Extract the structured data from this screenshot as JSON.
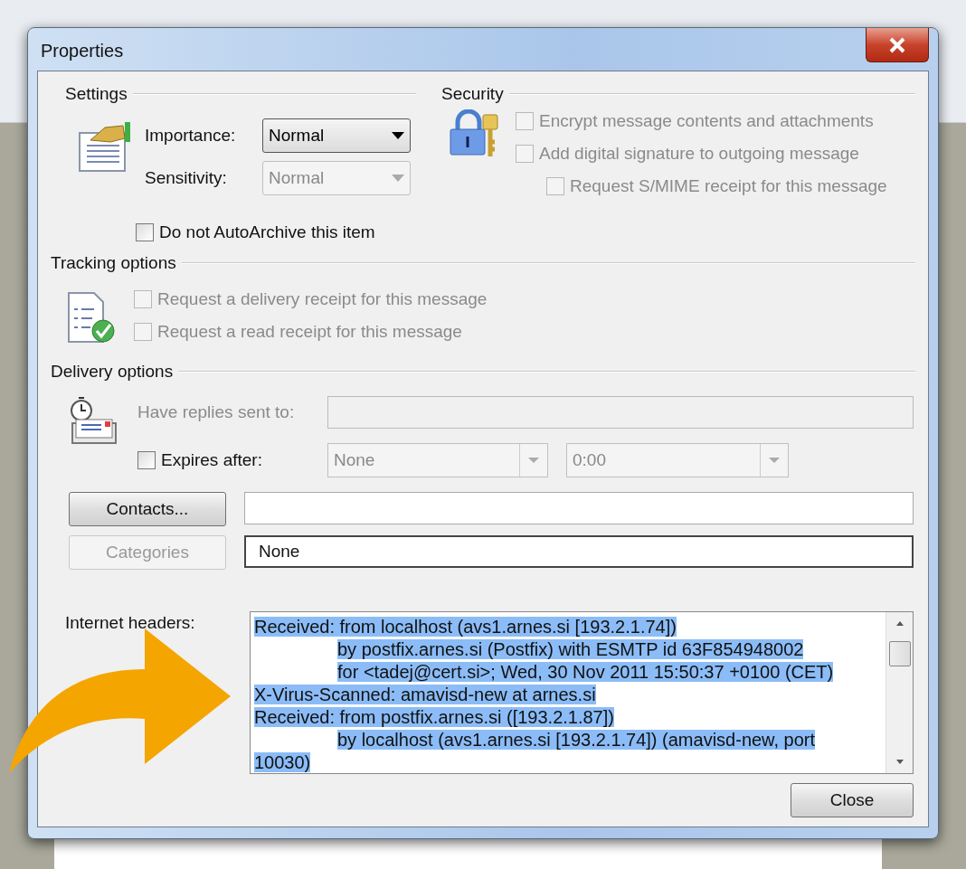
{
  "window": {
    "title": "Properties"
  },
  "settings": {
    "title": "Settings",
    "importance": {
      "label": "Importance:",
      "value": "Normal",
      "disabled": false
    },
    "sensitivity": {
      "label": "Sensitivity:",
      "value": "Normal",
      "disabled": true
    },
    "autoarchive": {
      "label": "Do not AutoArchive this item",
      "checked": false,
      "disabled": false
    }
  },
  "security": {
    "title": "Security",
    "options": [
      {
        "label": "Encrypt message contents and attachments",
        "checked": false,
        "disabled": true,
        "kind": "main"
      },
      {
        "label": "Add digital signature to outgoing message",
        "checked": false,
        "disabled": true,
        "kind": "main"
      },
      {
        "label": "Request S/MIME receipt for this message",
        "checked": false,
        "disabled": true,
        "kind": "sub"
      }
    ]
  },
  "tracking": {
    "title": "Tracking options",
    "options": [
      {
        "label": "Request a delivery receipt for this message",
        "checked": false,
        "disabled": true
      },
      {
        "label": "Request a read receipt for this message",
        "checked": false,
        "disabled": true
      }
    ]
  },
  "delivery": {
    "title": "Delivery options",
    "replies": {
      "label": "Have replies sent to:",
      "disabled": true
    },
    "expires": {
      "label": "Expires after:",
      "checked": false,
      "date": "None",
      "time": "0:00",
      "disabled": true
    },
    "contacts": {
      "label": "Contacts...",
      "disabled": false
    },
    "categories": {
      "label": "Categories",
      "disabled": true,
      "value": "None"
    }
  },
  "headers": {
    "label": "Internet headers:",
    "selected": true,
    "lines": [
      {
        "text": "Received: from localhost (avs1.arnes.si [193.2.1.74])",
        "kind": "start"
      },
      {
        "text": "by postfix.arnes.si (Postfix) with ESMTP id 63F854948002",
        "kind": "continuation"
      },
      {
        "text": "for <tadej@cert.si>; Wed, 30 Nov 2011 15:50:37 +0100 (CET)",
        "kind": "continuation"
      },
      {
        "text": "X-Virus-Scanned: amavisd-new at arnes.si",
        "kind": "start"
      },
      {
        "text": "Received: from postfix.arnes.si ([193.2.1.87])",
        "kind": "start"
      },
      {
        "text": "by localhost (avs1.arnes.si [193.2.1.74]) (amavisd-new, port",
        "kind": "continuation"
      },
      {
        "text": "10030)",
        "kind": "start"
      }
    ]
  },
  "buttons": {
    "close": "Close"
  }
}
